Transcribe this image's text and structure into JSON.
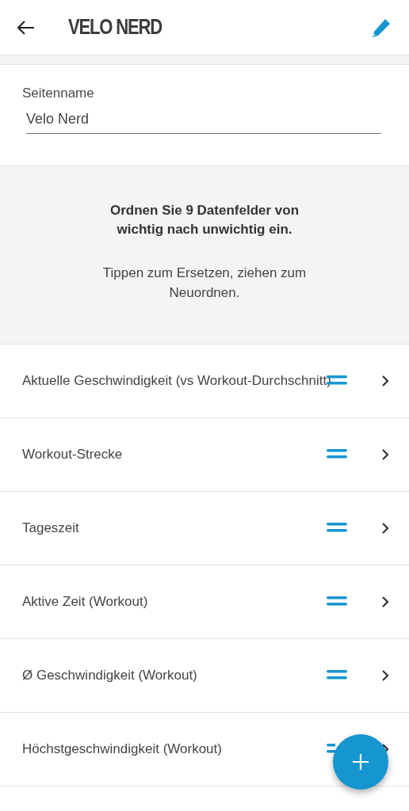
{
  "header": {
    "title": "VELO NERD"
  },
  "page_name": {
    "label": "Seitenname",
    "value": "Velo Nerd"
  },
  "info": {
    "heading": "Ordnen Sie 9 Datenfelder von wichtig nach unwichtig ein.",
    "hint": "Tippen zum Ersetzen, ziehen zum Neuordnen."
  },
  "fields": [
    {
      "label": "Aktuelle Geschwindigkeit (vs Workout-Durchschnitt)"
    },
    {
      "label": "Workout-Strecke"
    },
    {
      "label": "Tageszeit"
    },
    {
      "label": "Aktive Zeit (Workout)"
    },
    {
      "label": "Ø Geschwindigkeit (Workout)"
    },
    {
      "label": "Höchstgeschwindigkeit (Workout)"
    }
  ]
}
